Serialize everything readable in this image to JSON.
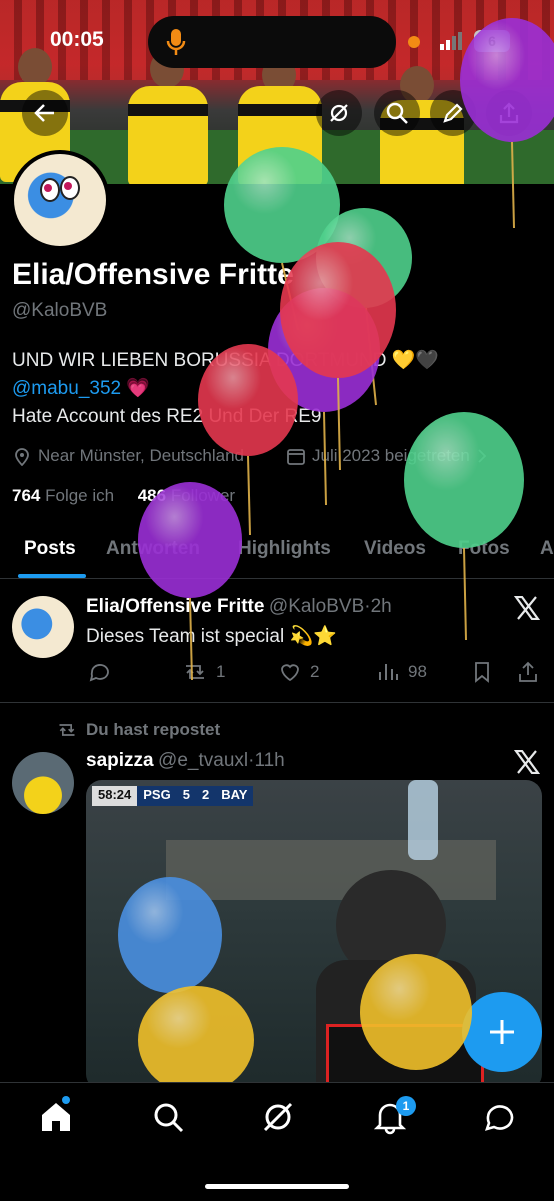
{
  "status_bar": {
    "time": "00:05",
    "battery": "6"
  },
  "profile": {
    "display_name": "Elia/Offensive Fritte",
    "handle": "@KaloBVB",
    "bio_line1": "UND WIR LIEBEN BORUSSIA DORTMUND 💛🖤",
    "bio_mention": "@mabu_352 💗",
    "bio_line3": "Hate Account des RE2 Und Der RE9",
    "location": "Near Münster, Deutschland",
    "joined": "Juli 2023 beigetreten",
    "following_count": "764",
    "following_label": "Folge ich",
    "followers_count": "486",
    "followers_label": "Follower"
  },
  "tabs": [
    "Posts",
    "Antworten",
    "Highlights",
    "Videos",
    "Fotos",
    "A"
  ],
  "tweets": [
    {
      "name": "Elia/Offensive Fritte",
      "handle": "@KaloBVB",
      "time": "2h",
      "text": "Dieses Team ist special 💫⭐",
      "retweets": "1",
      "likes": "2",
      "views": "98"
    },
    {
      "repost_label": "Du hast repostet",
      "name": "sapizza",
      "handle": "@e_tvauxl",
      "time": "11h",
      "media": {
        "clock": "58:24",
        "home": "PSG",
        "home_score": "5",
        "away_score": "2",
        "away": "BAY"
      }
    }
  ],
  "colors": {
    "accent": "#1d9bf0",
    "background": "#000000",
    "muted": "#71767b"
  },
  "nav": {
    "icons": [
      "home-icon",
      "search-icon",
      "grok-icon",
      "notifications-icon",
      "messages-icon"
    ],
    "notification_badge": "1"
  }
}
